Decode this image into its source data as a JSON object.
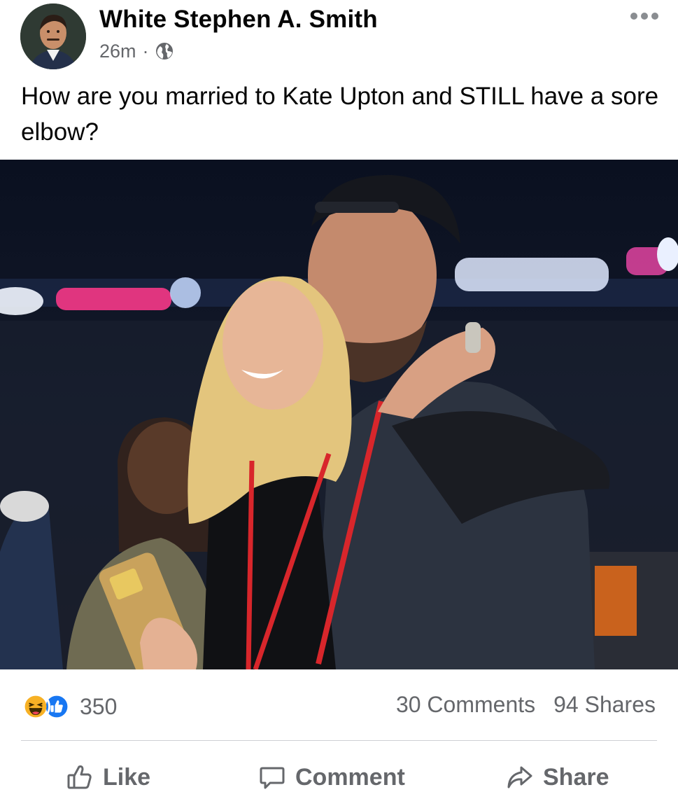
{
  "post": {
    "author": "White Stephen A. Smith",
    "time": "26m",
    "separator": "·",
    "privacy_icon": "globe-icon",
    "more_icon": "more-horizontal-icon",
    "text": "How are you married to Kate Upton and STILL have a sore elbow?",
    "photo_icon": "photo-image"
  },
  "stats": {
    "reaction_icons": [
      "haha-reaction-icon",
      "like-reaction-icon"
    ],
    "reaction_count": "350",
    "comments": "30 Comments",
    "shares": "94 Shares"
  },
  "actions": {
    "like": "Like",
    "comment": "Comment",
    "share": "Share"
  },
  "colors": {
    "secondary_text": "#65676b",
    "like_blue": "#1877f2",
    "haha_yellow": "#f7b125",
    "divider": "#ced0d4"
  }
}
